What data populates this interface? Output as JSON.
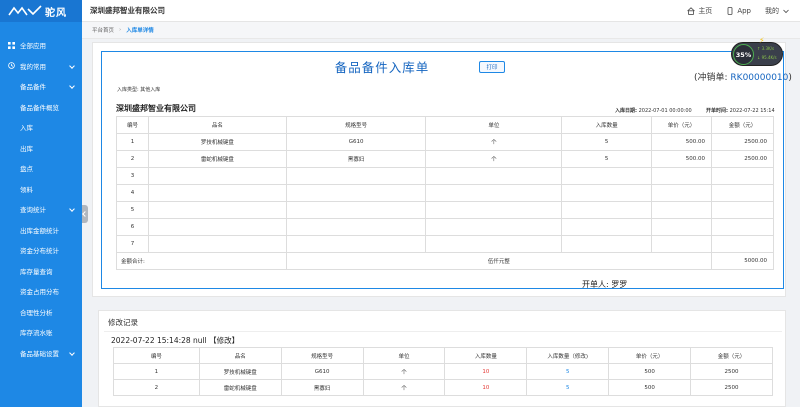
{
  "app": {
    "brand": "驼风",
    "company": "深圳盛邦智业有限公司"
  },
  "header": {
    "home": "主页",
    "app": "App",
    "mine": "我的"
  },
  "sidebar": {
    "items": [
      {
        "label": "全部应用",
        "level": "top"
      },
      {
        "label": "我的常用",
        "level": "top"
      },
      {
        "label": "备品备件",
        "level": "sub"
      },
      {
        "label": "备品备件概览",
        "level": "sub"
      },
      {
        "label": "入库",
        "level": "sub"
      },
      {
        "label": "出库",
        "level": "sub"
      },
      {
        "label": "盘点",
        "level": "sub"
      },
      {
        "label": "领料",
        "level": "sub"
      },
      {
        "label": "查询统计",
        "level": "sub"
      },
      {
        "label": "出库金额统计",
        "level": "sub"
      },
      {
        "label": "资金分布统计",
        "level": "sub"
      },
      {
        "label": "库存量查询",
        "level": "sub"
      },
      {
        "label": "资金占用分布",
        "level": "sub"
      },
      {
        "label": "合理性分析",
        "level": "sub"
      },
      {
        "label": "库存流水账",
        "level": "sub"
      },
      {
        "label": "备品基础设置",
        "level": "sub"
      }
    ]
  },
  "breadcrumb": {
    "home": "平台首页",
    "current": "入库单详情"
  },
  "doc": {
    "title": "备品备件入库单",
    "print": "打印",
    "flush_label": "(冲销单:",
    "flush_value": "RK00000010",
    "flush_close": ")",
    "type_label": "入库类型:",
    "type_value": "其他入库",
    "company": "深圳盛邦智业有限公司",
    "in_date_label": "入库日期:",
    "in_date_value": "2022-07-01 00:00:00",
    "open_time_label": "开单时间:",
    "open_time_value": "2022-07-22 15:14",
    "columns": [
      "编号",
      "品名",
      "规格型号",
      "单位",
      "入库数量",
      "单价（元）",
      "金额（元）"
    ],
    "rows": [
      [
        "1",
        "罗技机械键盘",
        "G610",
        "个",
        "5",
        "500.00",
        "2500.00"
      ],
      [
        "2",
        "雷蛇机械键盘",
        "黑寡妇",
        "个",
        "5",
        "500.00",
        "2500.00"
      ],
      [
        "3",
        "",
        "",
        "",
        "",
        "",
        ""
      ],
      [
        "4",
        "",
        "",
        "",
        "",
        "",
        ""
      ],
      [
        "5",
        "",
        "",
        "",
        "",
        "",
        ""
      ],
      [
        "6",
        "",
        "",
        "",
        "",
        "",
        ""
      ],
      [
        "7",
        "",
        "",
        "",
        "",
        "",
        ""
      ]
    ],
    "total_label": "金额合计:",
    "total_words": "伍仟元整",
    "total_value": "5000.00",
    "handler": "开单人:  罗罗"
  },
  "modify": {
    "title": "修改记录",
    "entry": "2022-07-22 15:14:28 null 【修改】",
    "columns": [
      "编号",
      "品名",
      "规格型号",
      "单位",
      "入库数量",
      "入库数量（修改)",
      "单价（元）",
      "金额（元）"
    ],
    "rows": [
      [
        "1",
        "罗技机械键盘",
        "G610",
        "个",
        "10",
        "5",
        "500",
        "2500"
      ],
      [
        "2",
        "雷蛇机械键盘",
        "黑寡妇",
        "个",
        "10",
        "5",
        "500",
        "2500"
      ]
    ]
  },
  "widget": {
    "percent": "35%",
    "up": "↑ 3.3K/s",
    "down": "↓ 95.4K/s"
  },
  "colors": {
    "primary": "#1e88e5",
    "sidebar": "#1e88e5",
    "title": "#1565c0",
    "danger": "#e53935"
  }
}
